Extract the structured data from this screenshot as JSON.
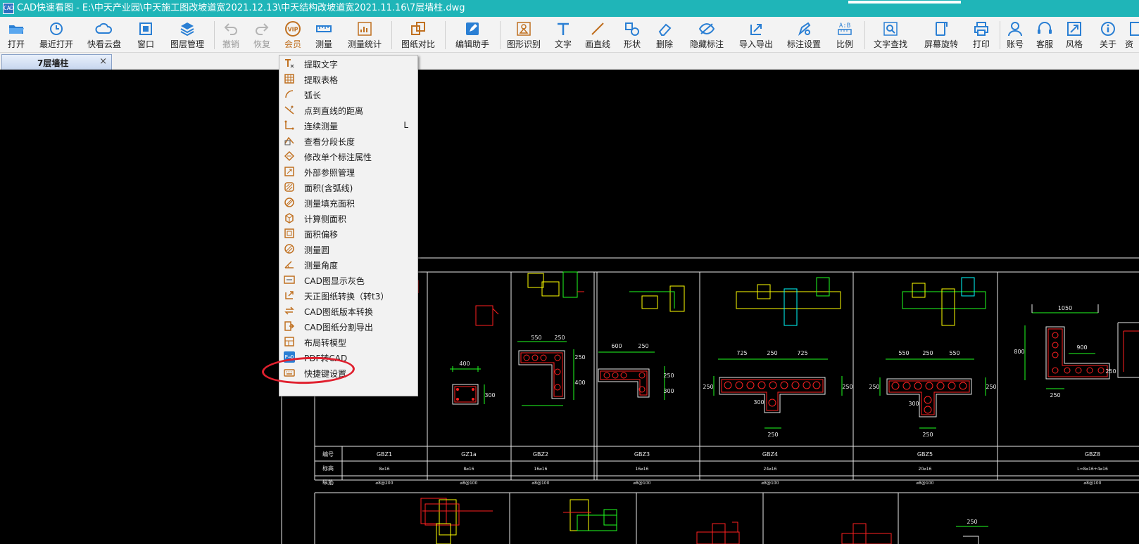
{
  "window": {
    "app_icon_text": "CAD",
    "title": "CAD快速看图 - E:\\中天产业园\\中天施工图改坡道宽2021.12.13\\中天结构改坡道宽2021.11.16\\7层墙柱.dwg"
  },
  "toolbar": {
    "items": [
      {
        "label": "打开",
        "icon": "folder-open-icon"
      },
      {
        "label": "最近打开",
        "icon": "history-icon"
      },
      {
        "label": "快看云盘",
        "icon": "cloud-icon"
      },
      {
        "label": "窗口",
        "icon": "window-icon"
      },
      {
        "label": "图层管理",
        "icon": "layers-icon"
      },
      {
        "label": "撤销",
        "icon": "undo-icon"
      },
      {
        "label": "恢复",
        "icon": "redo-icon"
      },
      {
        "label": "会员",
        "icon": "vip-icon",
        "badge": "VIP"
      },
      {
        "label": "测量",
        "icon": "measure-icon"
      },
      {
        "label": "测量统计",
        "icon": "measure-stats-icon"
      },
      {
        "label": "图纸对比",
        "icon": "compare-icon"
      },
      {
        "label": "编辑助手",
        "icon": "edit-assistant-icon"
      },
      {
        "label": "图形识别",
        "icon": "shape-recognize-icon"
      },
      {
        "label": "文字",
        "icon": "text-icon"
      },
      {
        "label": "画直线",
        "icon": "line-icon"
      },
      {
        "label": "形状",
        "icon": "shapes-icon"
      },
      {
        "label": "删除",
        "icon": "eraser-icon"
      },
      {
        "label": "隐藏标注",
        "icon": "hide-eye-icon"
      },
      {
        "label": "导入导出",
        "icon": "import-export-icon"
      },
      {
        "label": "标注设置",
        "icon": "annotation-settings-icon"
      },
      {
        "label": "比例",
        "icon": "scale-icon",
        "badge": "A:B"
      },
      {
        "label": "文字查找",
        "icon": "text-search-icon"
      },
      {
        "label": "屏幕旋转",
        "icon": "rotate-screen-icon"
      },
      {
        "label": "打印",
        "icon": "print-icon"
      },
      {
        "label": "账号",
        "icon": "account-icon"
      },
      {
        "label": "客服",
        "icon": "headset-icon"
      },
      {
        "label": "风格",
        "icon": "style-icon"
      },
      {
        "label": "关于",
        "icon": "info-icon"
      },
      {
        "label": "资",
        "icon": "resource-icon"
      }
    ]
  },
  "tabs": [
    {
      "label": "7层墙柱",
      "close": "×"
    }
  ],
  "menu": {
    "items": [
      {
        "label": "提取文字",
        "icon": "extract-text-icon"
      },
      {
        "label": "提取表格",
        "icon": "extract-table-icon"
      },
      {
        "label": "弧长",
        "icon": "arc-length-icon"
      },
      {
        "label": "点到直线的距离",
        "icon": "point-line-distance-icon"
      },
      {
        "label": "连续测量",
        "icon": "continuous-measure-icon",
        "shortcut": "L"
      },
      {
        "label": "查看分段长度",
        "icon": "segment-length-icon"
      },
      {
        "label": "修改单个标注属性",
        "icon": "edit-annotation-icon"
      },
      {
        "label": "外部参照管理",
        "icon": "xref-icon"
      },
      {
        "label": "面积(含弧线)",
        "icon": "area-arc-icon"
      },
      {
        "label": "测量填充面积",
        "icon": "hatch-area-icon"
      },
      {
        "label": "计算侧面积",
        "icon": "side-area-icon"
      },
      {
        "label": "面积偏移",
        "icon": "area-offset-icon"
      },
      {
        "label": "测量圆",
        "icon": "measure-circle-icon"
      },
      {
        "label": "测量角度",
        "icon": "measure-angle-icon"
      },
      {
        "label": "CAD图显示灰色",
        "icon": "gray-display-icon"
      },
      {
        "label": "天正图纸转换（转t3）",
        "icon": "tangent-convert-icon"
      },
      {
        "label": "CAD图纸版本转换",
        "icon": "version-convert-icon"
      },
      {
        "label": "CAD图纸分割导出",
        "icon": "split-export-icon"
      },
      {
        "label": "布局转模型",
        "icon": "layout-model-icon"
      },
      {
        "label": "PDF转CAD",
        "icon": "pdf-to-cad-icon",
        "icon_text": "P→D"
      },
      {
        "label": "快捷键设置",
        "icon": "shortcut-settings-icon"
      }
    ]
  },
  "drawing": {
    "column_labels": [
      "GBZ1",
      "GZ1a",
      "GBZ2",
      "GBZ3",
      "GBZ4",
      "GBZ5",
      "GBZ8"
    ],
    "row_headers": [
      "编号",
      "标高",
      "纵筋"
    ],
    "row2": [
      "8⌀16",
      "8⌀16",
      "16⌀16",
      "16⌀16",
      "24⌀16",
      "20⌀16",
      "L=8⌀16+4⌀16"
    ],
    "row3": [
      "⌀8@200",
      "⌀8@100",
      "⌀8@100",
      "⌀8@100",
      "⌀8@100",
      "⌀8@100",
      "⌀8@100"
    ],
    "dims": {
      "gz1a_w": "400",
      "gz1a_h": "300",
      "gbz2_a": "550",
      "gbz2_b": "250",
      "gbz2_c": "250",
      "gbz2_d": "400",
      "gbz3_a": "600",
      "gbz3_b": "250",
      "gbz3_c": "250",
      "gbz3_d": "300",
      "gbz4_a": "725",
      "gbz4_b": "250",
      "gbz4_c": "725",
      "gbz4_d": "250",
      "gbz4_e": "250",
      "gbz4_f": "300",
      "gbz4_g": "250",
      "gbz5_a": "550",
      "gbz5_b": "250",
      "gbz5_c": "550",
      "gbz5_d": "250",
      "gbz5_e": "250",
      "gbz5_f": "300",
      "gbz5_g": "250",
      "gbz8_a": "1050",
      "gbz8_b": "800",
      "gbz8_c": "250",
      "gbz8_d": "250",
      "gbz8_e": "900",
      "bottom_dim": "250"
    }
  }
}
